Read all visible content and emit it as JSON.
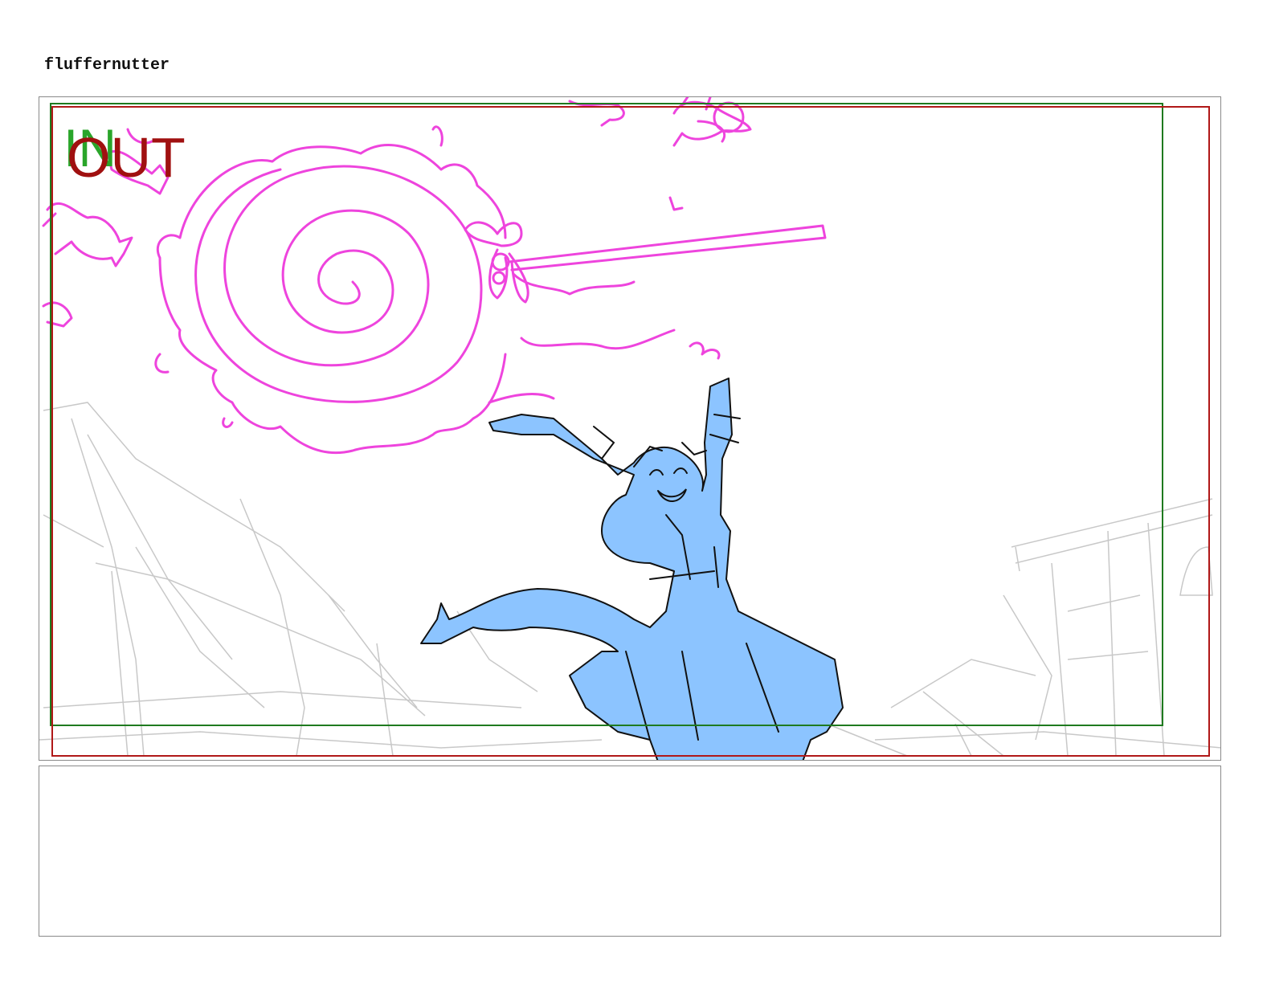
{
  "page": {
    "title": "fluffernutter"
  },
  "panel": {
    "in_label": "IN",
    "out_label": "OUT",
    "colors": {
      "in_frame": "#1f7a1f",
      "out_frame": "#b01818",
      "effect_sketch": "#ee44dd",
      "character_fill": "#8cc4ff",
      "line_art": "#111111",
      "background_sketch": "#c8c8c8"
    }
  },
  "notes": {
    "text": ""
  }
}
